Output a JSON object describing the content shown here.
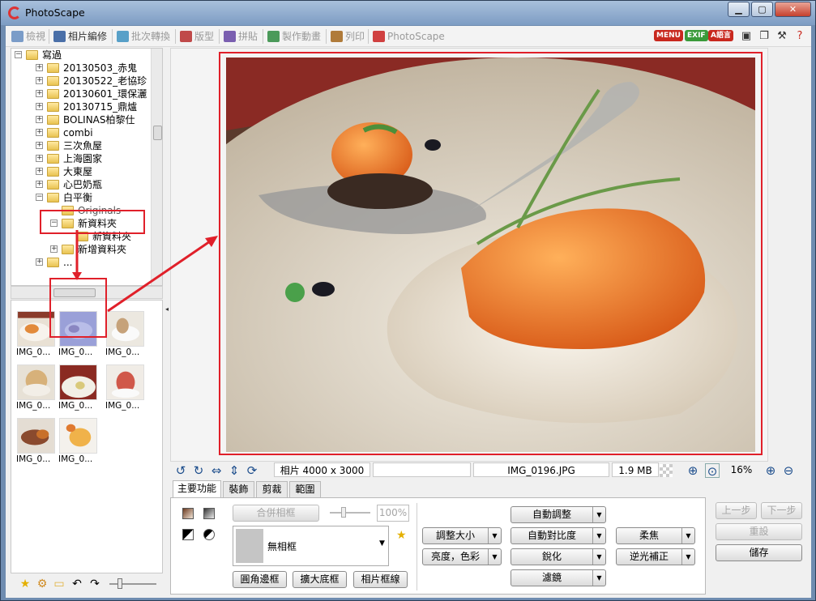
{
  "window": {
    "title": "PhotoScape",
    "min": "▁",
    "max": "▢",
    "close": "✕"
  },
  "tabs": [
    {
      "label": "檢視",
      "color": "#5a7fb5"
    },
    {
      "label": "相片編修",
      "color": "#4a6fa8"
    },
    {
      "label": "批次轉換",
      "color": "#58a0c8"
    },
    {
      "label": "版型",
      "color": "#c04a4a"
    },
    {
      "label": "拼貼",
      "color": "#7a5fb0"
    },
    {
      "label": "製作動畫",
      "color": "#4b9a5a"
    },
    {
      "label": "列印",
      "color": "#b07b3a"
    },
    {
      "label": "PhotoScape",
      "color": "#d04040"
    }
  ],
  "toolbar_right": {
    "menu": "MENU",
    "exif": "EXIF",
    "lang": "A語言"
  },
  "tree": {
    "items": [
      "寫過",
      "20130503_赤鬼",
      "20130522_老協珍",
      "20130601_環保灑",
      "20130715_鼎爐",
      "BOLINAS柏黎仕",
      "combi",
      "三次魚屋",
      "上海園家",
      "大東屋",
      "心巴奶瓶",
      "白平衡",
      "Originals",
      "新資料夾",
      "新資料夾",
      "新增資料夾",
      "..."
    ]
  },
  "thumbnails": {
    "captions": [
      "IMG_0...",
      "IMG_0...",
      "IMG_0...",
      "IMG_0...",
      "IMG_0...",
      "IMG_0...",
      "IMG_0...",
      "IMG_0..."
    ]
  },
  "status": {
    "size": "相片 4000 x 3000",
    "empty": "",
    "filename": "IMG_0196.JPG",
    "filesize": "1.9 MB",
    "zoom": "16%"
  },
  "tool_tabs": [
    "主要功能",
    "裝飾",
    "剪裁",
    "範圍"
  ],
  "tools": {
    "merge_frame": "合併相框",
    "percent": "100%",
    "frame_select": "無相框",
    "round_corner": "圓角邊框",
    "expand_bottom": "擴大底框",
    "frame_line": "相片框線",
    "resize": "調整大小",
    "brightness": "亮度，色彩",
    "auto_level": "自動調整",
    "auto_contrast": "自動對比度",
    "sharpen": "銳化",
    "filter": "濾鏡",
    "soften": "柔焦",
    "backlight": "逆光補正"
  },
  "actions": {
    "undo": "上一步",
    "redo": "下一步",
    "reset": "重設",
    "save": "儲存"
  },
  "annotation": {
    "color": "#e0202a"
  }
}
